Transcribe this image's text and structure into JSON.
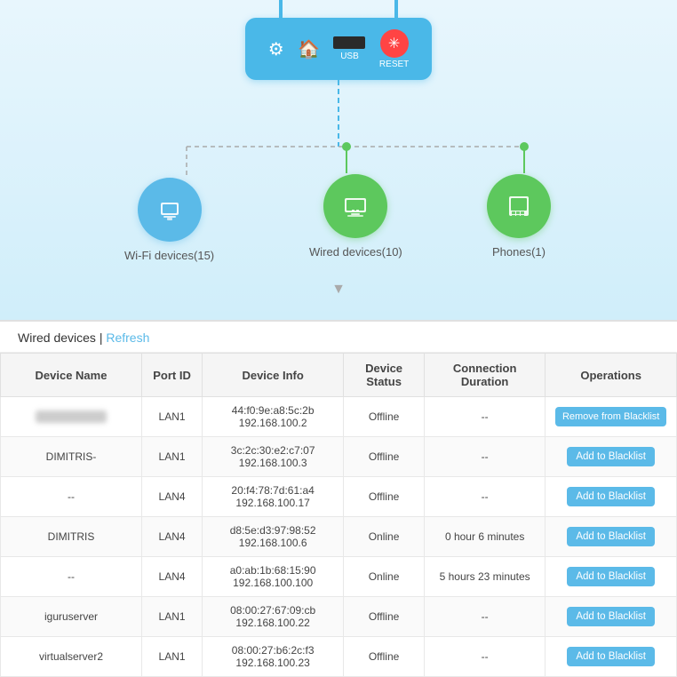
{
  "diagram": {
    "router": {
      "usb_label": "USB",
      "reset_label": "RESET"
    },
    "devices": [
      {
        "label": "Wi-Fi devices(15)",
        "type": "blue",
        "icon": "📱"
      },
      {
        "label": "Wired devices(10)",
        "type": "green",
        "icon": "🖥"
      },
      {
        "label": "Phones(1)",
        "type": "green",
        "icon": "📠"
      }
    ]
  },
  "table": {
    "title": "Wired devices",
    "refresh_label": "Refresh",
    "separator": "|",
    "columns": [
      "Device Name",
      "Port ID",
      "Device Info",
      "Device Status",
      "Connection Duration",
      "Operations"
    ],
    "rows": [
      {
        "device_name": "BLURRED",
        "port": "LAN1",
        "device_info_mac": "44:f0:9e:a8:5c:2b",
        "device_info_ip": "192.168.100.2",
        "status": "Offline",
        "duration": "--",
        "operation": "Remove from Blacklist",
        "op_type": "remove"
      },
      {
        "device_name": "DIMITRIS-",
        "port": "LAN1",
        "device_info_mac": "3c:2c:30:e2:c7:07",
        "device_info_ip": "192.168.100.3",
        "status": "Offline",
        "duration": "--",
        "operation": "Add to Blacklist",
        "op_type": "add"
      },
      {
        "device_name": "--",
        "port": "LAN4",
        "device_info_mac": "20:f4:78:7d:61:a4",
        "device_info_ip": "192.168.100.17",
        "status": "Offline",
        "duration": "--",
        "operation": "Add to Blacklist",
        "op_type": "add"
      },
      {
        "device_name": "DIMITRIS",
        "port": "LAN4",
        "device_info_mac": "d8:5e:d3:97:98:52",
        "device_info_ip": "192.168.100.6",
        "status": "Online",
        "duration": "0 hour 6 minutes",
        "operation": "Add to Blacklist",
        "op_type": "add"
      },
      {
        "device_name": "--",
        "port": "LAN4",
        "device_info_mac": "a0:ab:1b:68:15:90",
        "device_info_ip": "192.168.100.100",
        "status": "Online",
        "duration": "5 hours 23 minutes",
        "operation": "Add to Blacklist",
        "op_type": "add"
      },
      {
        "device_name": "iguruserver",
        "port": "LAN1",
        "device_info_mac": "08:00:27:67:09:cb",
        "device_info_ip": "192.168.100.22",
        "status": "Offline",
        "duration": "--",
        "operation": "Add to Blacklist",
        "op_type": "add"
      },
      {
        "device_name": "virtualserver2",
        "port": "LAN1",
        "device_info_mac": "08:00:27:b6:2c:f3",
        "device_info_ip": "192.168.100.23",
        "status": "Offline",
        "duration": "--",
        "operation": "Add to Blacklist",
        "op_type": "add"
      }
    ]
  }
}
